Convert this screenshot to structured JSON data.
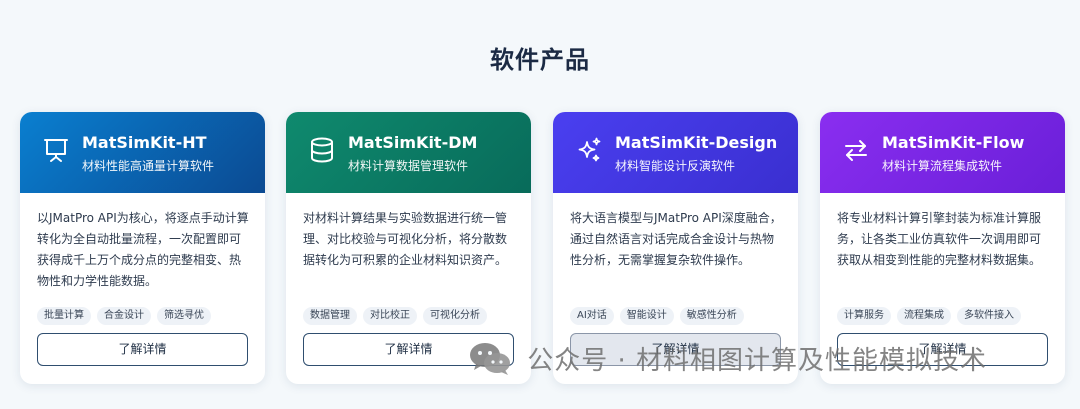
{
  "section_title": "软件产品",
  "cards": [
    {
      "name": "MatSimKit-HT",
      "subtitle": "材料性能高通量计算软件",
      "icon": "presentation-board-icon",
      "gradient_from": "#0a7fd0",
      "gradient_to": "#0b4a92",
      "description": "以JMatPro API为核心，将逐点手动计算转化为全自动批量流程，一次配置即可获得成千上万个成分点的完整相变、热物性和力学性能数据。",
      "tags": [
        "批量计算",
        "合金设计",
        "筛选寻优"
      ],
      "button_label": "了解详情"
    },
    {
      "name": "MatSimKit-DM",
      "subtitle": "材料计算数据管理软件",
      "icon": "database-icon",
      "gradient_from": "#0f8a6e",
      "gradient_to": "#086b5a",
      "description": "对材料计算结果与实验数据进行统一管理、对比校验与可视化分析，将分散数据转化为可积累的企业材料知识资产。",
      "tags": [
        "数据管理",
        "对比校正",
        "可视化分析"
      ],
      "button_label": "了解详情"
    },
    {
      "name": "MatSimKit-Design",
      "subtitle": "材料智能设计反演软件",
      "icon": "sparkles-icon",
      "gradient_from": "#4a3ff0",
      "gradient_to": "#3a2fd0",
      "description": "将大语言模型与JMatPro API深度融合，通过自然语言对话完成合金设计与热物性分析，无需掌握复杂软件操作。",
      "tags": [
        "AI对话",
        "智能设计",
        "敏感性分析"
      ],
      "button_label": "了解详情"
    },
    {
      "name": "MatSimKit-Flow",
      "subtitle": "材料计算流程集成软件",
      "icon": "arrows-exchange-icon",
      "gradient_from": "#8a2ef0",
      "gradient_to": "#6a1fd8",
      "description": "将专业材料计算引擎封装为标准计算服务，让各类工业仿真软件一次调用即可获取从相变到性能的完整材料数据集。",
      "tags": [
        "计算服务",
        "流程集成",
        "多软件接入"
      ],
      "button_label": "了解详情"
    }
  ],
  "watermark": {
    "text": "公众号 · 材料相图计算及性能模拟技术",
    "icon": "wechat-icon"
  }
}
